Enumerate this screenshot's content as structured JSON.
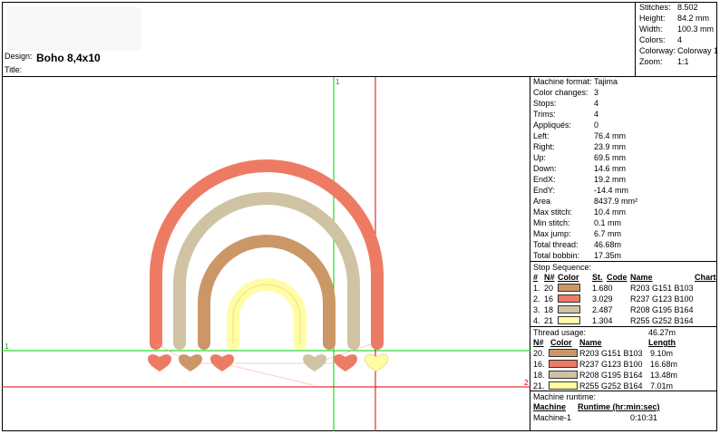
{
  "header": {
    "design_label": "Design:",
    "design_value": "Boho 8,4x10",
    "title_label": "Title:",
    "stats": [
      {
        "label": "Stitches:",
        "value": "8.502"
      },
      {
        "label": "Height:",
        "value": "84.2 mm"
      },
      {
        "label": "Width:",
        "value": "100.3 mm"
      },
      {
        "label": "Colors:",
        "value": "4"
      },
      {
        "label": "Colorway:",
        "value": "Colorway 1"
      },
      {
        "label": "Zoom:",
        "value": "1:1"
      }
    ]
  },
  "canvas": {
    "axis_label_1": "1",
    "axis_label_2": "2",
    "colors": {
      "c20": "#CB9767",
      "c16": "#ED7B64",
      "c18": "#D0C3A4",
      "c21": "#FFFCA4",
      "green": "#00cc00",
      "red": "#e00000"
    }
  },
  "machine_info": [
    {
      "label": "Machine format:",
      "value": "Tajima"
    },
    {
      "label": "Color changes:",
      "value": "3"
    },
    {
      "label": "Stops:",
      "value": "4"
    },
    {
      "label": "Trims:",
      "value": "4"
    },
    {
      "label": "Appliqués:",
      "value": "0"
    },
    {
      "label": "Left:",
      "value": "76.4 mm"
    },
    {
      "label": "Right:",
      "value": "23.9 mm"
    },
    {
      "label": "Up:",
      "value": "69.5 mm"
    },
    {
      "label": "Down:",
      "value": "14.6 mm"
    },
    {
      "label": "EndX:",
      "value": "19.2 mm"
    },
    {
      "label": "EndY:",
      "value": "-14.4 mm"
    },
    {
      "label": "Area",
      "value": "8437.9 mm²"
    },
    {
      "label": "Max stitch:",
      "value": "10.4 mm"
    },
    {
      "label": "Min stitch:",
      "value": "0.1 mm"
    },
    {
      "label": "Max jump:",
      "value": "6.7 mm"
    },
    {
      "label": "Total thread:",
      "value": "46.68m"
    },
    {
      "label": "Total bobbin:",
      "value": "17.35m"
    }
  ],
  "stop_sequence": {
    "title": "Stop Sequence:",
    "headers": {
      "num": "#",
      "n": "N#",
      "color": "Color",
      "st": "St.",
      "code": "Code",
      "name": "Name",
      "chart": "Chart"
    },
    "rows": [
      {
        "num": "1.",
        "n": "20",
        "color": "#CB9767",
        "st": "1.680",
        "code": "",
        "name": "R203 G151 B103"
      },
      {
        "num": "2.",
        "n": "16",
        "color": "#ED7B64",
        "st": "3.029",
        "code": "",
        "name": "R237 G123 B100"
      },
      {
        "num": "3.",
        "n": "18",
        "color": "#D0C3A4",
        "st": "2.487",
        "code": "",
        "name": "R208 G195 B164"
      },
      {
        "num": "4.",
        "n": "21",
        "color": "#FFFCA4",
        "st": "1.304",
        "code": "",
        "name": "R255 G252 B164"
      }
    ]
  },
  "thread_usage": {
    "label": "Thread usage:",
    "total": "46.27m",
    "headers": {
      "n": "N#",
      "color": "Color",
      "name": "Name",
      "length": "Length"
    },
    "rows": [
      {
        "n": "20.",
        "color": "#CB9767",
        "name": "R203 G151 B103",
        "length": "9.10m"
      },
      {
        "n": "16.",
        "color": "#ED7B64",
        "name": "R237 G123 B100",
        "length": "16.68m"
      },
      {
        "n": "18.",
        "color": "#D0C3A4",
        "name": "R208 G195 B164",
        "length": "13.48m"
      },
      {
        "n": "21.",
        "color": "#FFFCA4",
        "name": "R255 G252 B164",
        "length": "7.01m"
      }
    ]
  },
  "runtime": {
    "title": "Machine runtime:",
    "headers": {
      "machine": "Machine",
      "runtime": "Runtime (hr:min:sec)"
    },
    "rows": [
      {
        "machine": "Machine-1",
        "runtime": "0:10:31"
      }
    ]
  }
}
